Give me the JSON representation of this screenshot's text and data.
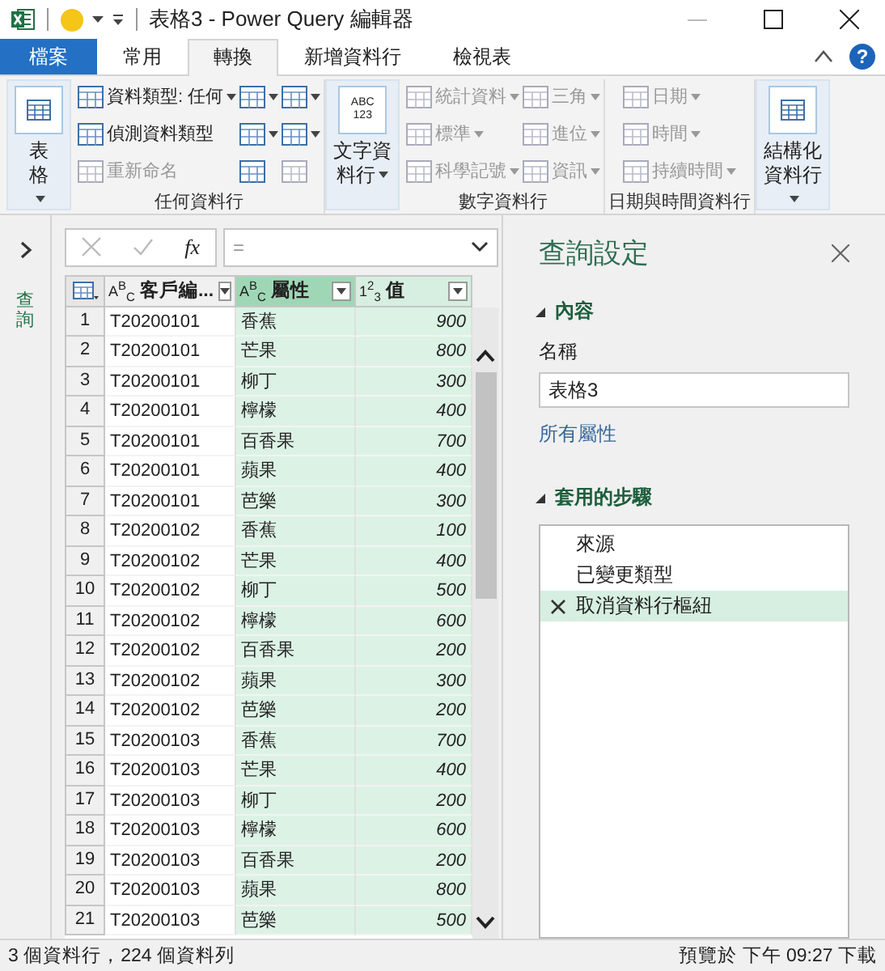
{
  "window": {
    "title": "表格3 - Power Query 編輯器"
  },
  "tabs": [
    {
      "label": "檔案",
      "kind": "file",
      "selected": false
    },
    {
      "label": "常用",
      "kind": "tab",
      "selected": false
    },
    {
      "label": "轉換",
      "kind": "tab",
      "selected": true
    },
    {
      "label": "新增資料行",
      "kind": "tab",
      "selected": false
    },
    {
      "label": "檢視表",
      "kind": "tab",
      "selected": false
    }
  ],
  "help": {
    "label": "?"
  },
  "ribbon": {
    "groups": [
      {
        "columns": [
          [
            {
              "kind": "big",
              "label": "表格",
              "dropdown": true,
              "disabled": false
            }
          ]
        ]
      },
      {
        "label": "任何資料行",
        "columns": [
          [
            {
              "kind": "small",
              "label": "資料類型: 任何",
              "dropdown": true,
              "disabled": false
            },
            {
              "kind": "small",
              "label": "偵測資料類型",
              "dropdown": false,
              "disabled": false
            },
            {
              "kind": "small",
              "label": "重新命名",
              "dropdown": false,
              "disabled": true
            }
          ],
          [
            {
              "kind": "icon",
              "dropdown": true,
              "disabled": false
            },
            {
              "kind": "icon",
              "dropdown": true,
              "disabled": false
            },
            {
              "kind": "icon",
              "dropdown": false,
              "disabled": false
            }
          ],
          [
            {
              "kind": "icon",
              "dropdown": true,
              "disabled": false
            },
            {
              "kind": "icon",
              "dropdown": true,
              "disabled": false
            },
            {
              "kind": "icon",
              "dropdown": false,
              "disabled": true
            }
          ]
        ]
      },
      {
        "columns": [
          [
            {
              "kind": "big",
              "label": "文字資料行",
              "icon_text": "ABC 123",
              "dropdown": true,
              "disabled": false
            }
          ]
        ]
      },
      {
        "label": "數字資料行",
        "columns": [
          [
            {
              "kind": "small",
              "label": "統計資料",
              "dropdown": true,
              "disabled": true
            },
            {
              "kind": "small",
              "label": "標準",
              "dropdown": true,
              "disabled": true
            },
            {
              "kind": "small",
              "label": "科學記號",
              "dropdown": true,
              "disabled": true
            }
          ],
          [
            {
              "kind": "small",
              "label": "三角",
              "dropdown": true,
              "disabled": true
            },
            {
              "kind": "small",
              "label": "進位",
              "dropdown": true,
              "disabled": true
            },
            {
              "kind": "small",
              "label": "資訊",
              "dropdown": true,
              "disabled": true
            }
          ]
        ]
      },
      {
        "label": "日期與時間資料行",
        "columns": [
          [
            {
              "kind": "small",
              "label": "日期",
              "dropdown": true,
              "disabled": true
            },
            {
              "kind": "small",
              "label": "時間",
              "dropdown": true,
              "disabled": true
            },
            {
              "kind": "small",
              "label": "持續時間",
              "dropdown": true,
              "disabled": true
            }
          ]
        ]
      },
      {
        "columns": [
          [
            {
              "kind": "big",
              "label": "結構化資料行",
              "dropdown": true,
              "disabled": false
            }
          ]
        ]
      }
    ]
  },
  "queries_pane": {
    "label": "查詢"
  },
  "formula_bar": {
    "fx_label": "fx",
    "formula": "="
  },
  "table": {
    "columns": [
      {
        "type_label": "A$^{B}$$_{C}$",
        "name": "客戶編...",
        "selected": false,
        "active": false
      },
      {
        "type_label": "A$^{B}$$_{C}$",
        "name": "屬性",
        "selected": true,
        "active": true
      },
      {
        "type_label": "1$^{2}$$_{3}$",
        "name": "值",
        "selected": true,
        "active": false
      }
    ],
    "rows": [
      {
        "number": "1",
        "cells": [
          "T20200101",
          "香蕉",
          "900"
        ]
      },
      {
        "number": "2",
        "cells": [
          "T20200101",
          "芒果",
          "800"
        ]
      },
      {
        "number": "3",
        "cells": [
          "T20200101",
          "柳丁",
          "300"
        ]
      },
      {
        "number": "4",
        "cells": [
          "T20200101",
          "檸檬",
          "400"
        ]
      },
      {
        "number": "5",
        "cells": [
          "T20200101",
          "百香果",
          "700"
        ]
      },
      {
        "number": "6",
        "cells": [
          "T20200101",
          "蘋果",
          "400"
        ]
      },
      {
        "number": "7",
        "cells": [
          "T20200101",
          "芭樂",
          "300"
        ]
      },
      {
        "number": "8",
        "cells": [
          "T20200102",
          "香蕉",
          "100"
        ]
      },
      {
        "number": "9",
        "cells": [
          "T20200102",
          "芒果",
          "400"
        ]
      },
      {
        "number": "10",
        "cells": [
          "T20200102",
          "柳丁",
          "500"
        ]
      },
      {
        "number": "11",
        "cells": [
          "T20200102",
          "檸檬",
          "600"
        ]
      },
      {
        "number": "12",
        "cells": [
          "T20200102",
          "百香果",
          "200"
        ]
      },
      {
        "number": "13",
        "cells": [
          "T20200102",
          "蘋果",
          "300"
        ]
      },
      {
        "number": "14",
        "cells": [
          "T20200102",
          "芭樂",
          "200"
        ]
      },
      {
        "number": "15",
        "cells": [
          "T20200103",
          "香蕉",
          "700"
        ]
      },
      {
        "number": "16",
        "cells": [
          "T20200103",
          "芒果",
          "400"
        ]
      },
      {
        "number": "17",
        "cells": [
          "T20200103",
          "柳丁",
          "200"
        ]
      },
      {
        "number": "18",
        "cells": [
          "T20200103",
          "檸檬",
          "600"
        ]
      },
      {
        "number": "19",
        "cells": [
          "T20200103",
          "百香果",
          "200"
        ]
      },
      {
        "number": "20",
        "cells": [
          "T20200103",
          "蘋果",
          "800"
        ]
      },
      {
        "number": "21",
        "cells": [
          "T20200103",
          "芭樂",
          "500"
        ]
      }
    ]
  },
  "query_settings": {
    "title": "查詢設定",
    "properties": {
      "label": "內容",
      "expanded": true,
      "name_label": "名稱",
      "name_value": "表格3",
      "link": "所有屬性"
    },
    "steps_section": {
      "label": "套用的步驟",
      "expanded": true
    },
    "steps": [
      {
        "label": "來源",
        "selected": false
      },
      {
        "label": "已變更類型",
        "selected": false
      },
      {
        "label": "取消資料行樞紐",
        "selected": true
      }
    ]
  },
  "status_bar": {
    "left": "3 個資料行，224 個資料列",
    "right": "預覽於 下午 09:27 下載"
  }
}
